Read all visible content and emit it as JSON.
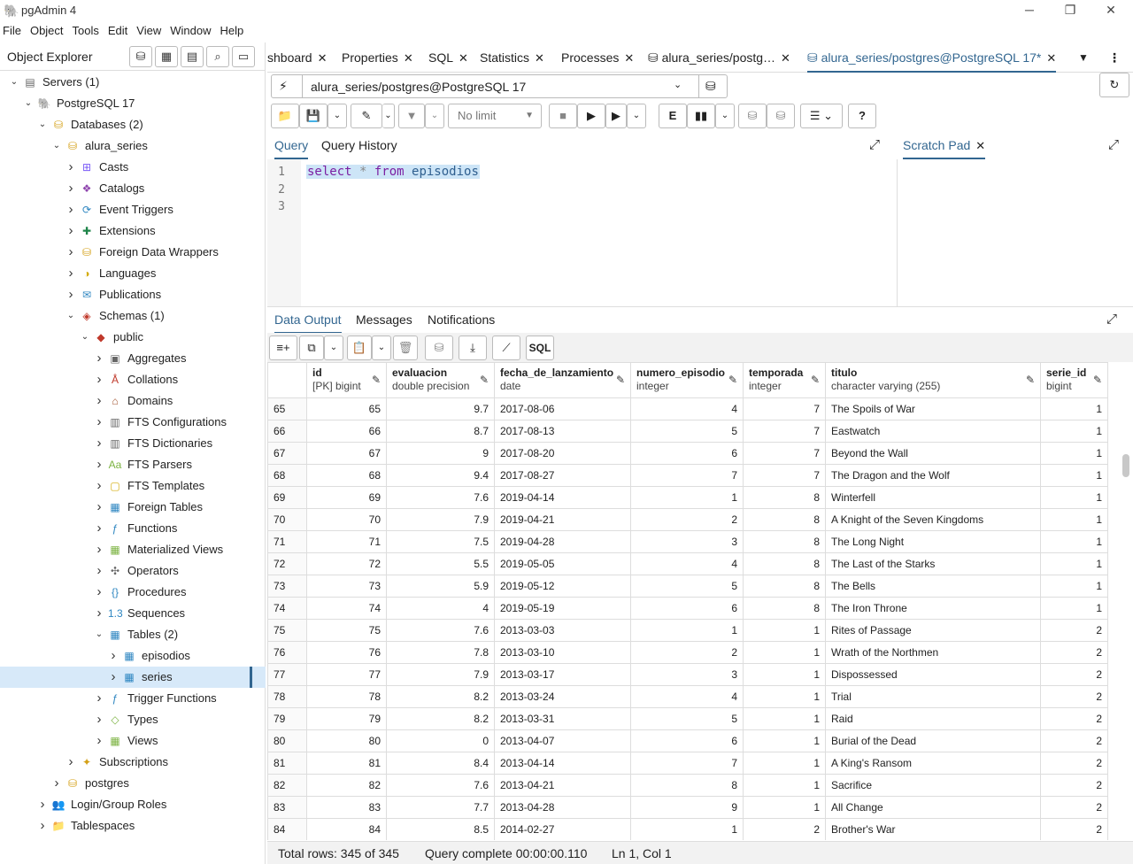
{
  "app": {
    "title": "pgAdmin 4"
  },
  "menu": [
    "File",
    "Object",
    "Tools",
    "Edit",
    "View",
    "Window",
    "Help"
  ],
  "object_explorer": {
    "title": "Object Explorer",
    "tree": [
      {
        "label": "Servers (1)",
        "icon": "servers-icon",
        "depth": 0,
        "chevron": "down"
      },
      {
        "label": "PostgreSQL 17",
        "icon": "elephant-icon",
        "depth": 1,
        "chevron": "down"
      },
      {
        "label": "Databases (2)",
        "icon": "databases-icon",
        "depth": 2,
        "chevron": "down"
      },
      {
        "label": "alura_series",
        "icon": "database-icon",
        "depth": 3,
        "chevron": "down"
      },
      {
        "label": "Casts",
        "icon": "casts-icon",
        "depth": 4,
        "chevron": "right"
      },
      {
        "label": "Catalogs",
        "icon": "catalogs-icon",
        "depth": 4,
        "chevron": "right"
      },
      {
        "label": "Event Triggers",
        "icon": "event-triggers-icon",
        "depth": 4,
        "chevron": "right"
      },
      {
        "label": "Extensions",
        "icon": "extensions-icon",
        "depth": 4,
        "chevron": "right"
      },
      {
        "label": "Foreign Data Wrappers",
        "icon": "fdw-icon",
        "depth": 4,
        "chevron": "right"
      },
      {
        "label": "Languages",
        "icon": "languages-icon",
        "depth": 4,
        "chevron": "right"
      },
      {
        "label": "Publications",
        "icon": "publications-icon",
        "depth": 4,
        "chevron": "right"
      },
      {
        "label": "Schemas (1)",
        "icon": "schemas-icon",
        "depth": 4,
        "chevron": "down"
      },
      {
        "label": "public",
        "icon": "schema-icon",
        "depth": 5,
        "chevron": "down"
      },
      {
        "label": "Aggregates",
        "icon": "aggregates-icon",
        "depth": 6,
        "chevron": "right"
      },
      {
        "label": "Collations",
        "icon": "collations-icon",
        "depth": 6,
        "chevron": "right"
      },
      {
        "label": "Domains",
        "icon": "domains-icon",
        "depth": 6,
        "chevron": "right"
      },
      {
        "label": "FTS Configurations",
        "icon": "fts-config-icon",
        "depth": 6,
        "chevron": "right"
      },
      {
        "label": "FTS Dictionaries",
        "icon": "fts-dict-icon",
        "depth": 6,
        "chevron": "right"
      },
      {
        "label": "FTS Parsers",
        "icon": "fts-parsers-icon",
        "depth": 6,
        "chevron": "right"
      },
      {
        "label": "FTS Templates",
        "icon": "fts-templates-icon",
        "depth": 6,
        "chevron": "right"
      },
      {
        "label": "Foreign Tables",
        "icon": "foreign-tables-icon",
        "depth": 6,
        "chevron": "right"
      },
      {
        "label": "Functions",
        "icon": "functions-icon",
        "depth": 6,
        "chevron": "right"
      },
      {
        "label": "Materialized Views",
        "icon": "mat-views-icon",
        "depth": 6,
        "chevron": "right"
      },
      {
        "label": "Operators",
        "icon": "operators-icon",
        "depth": 6,
        "chevron": "right"
      },
      {
        "label": "Procedures",
        "icon": "procedures-icon",
        "depth": 6,
        "chevron": "right"
      },
      {
        "label": "Sequences",
        "icon": "sequences-icon",
        "depth": 6,
        "chevron": "right"
      },
      {
        "label": "Tables (2)",
        "icon": "tables-icon",
        "depth": 6,
        "chevron": "down"
      },
      {
        "label": "episodios",
        "icon": "table-icon",
        "depth": 7,
        "chevron": "right"
      },
      {
        "label": "series",
        "icon": "table-icon",
        "depth": 7,
        "chevron": "right",
        "selected": true
      },
      {
        "label": "Trigger Functions",
        "icon": "trigger-functions-icon",
        "depth": 6,
        "chevron": "right"
      },
      {
        "label": "Types",
        "icon": "types-icon",
        "depth": 6,
        "chevron": "right"
      },
      {
        "label": "Views",
        "icon": "views-icon",
        "depth": 6,
        "chevron": "right"
      },
      {
        "label": "Subscriptions",
        "icon": "subscriptions-icon",
        "depth": 4,
        "chevron": "right"
      },
      {
        "label": "postgres",
        "icon": "database-icon",
        "depth": 3,
        "chevron": "right"
      },
      {
        "label": "Login/Group Roles",
        "icon": "roles-icon",
        "depth": 2,
        "chevron": "right"
      },
      {
        "label": "Tablespaces",
        "icon": "tablespaces-icon",
        "depth": 2,
        "chevron": "right"
      }
    ]
  },
  "tabs": [
    "shboard",
    "Properties",
    "SQL",
    "Statistics",
    "Processes",
    "alura_series/postg…",
    "alura_series/postgres@PostgreSQL 17*"
  ],
  "connection": "alura_series/postgres@PostgreSQL 17",
  "toolbar": {
    "limit": "No limit"
  },
  "query_tabs": [
    "Query",
    "Query History"
  ],
  "scratch_pad": "Scratch Pad",
  "editor": {
    "line_numbers": [
      "1",
      "2",
      "3"
    ],
    "tokens": [
      {
        "text": "select",
        "kind": "kw"
      },
      {
        "text": " * ",
        "kind": "op"
      },
      {
        "text": "from",
        "kind": "kw"
      },
      {
        "text": " episodios",
        "kind": "id"
      }
    ]
  },
  "output_tabs": [
    "Data Output",
    "Messages",
    "Notifications"
  ],
  "sql_button": "SQL",
  "grid": {
    "columns": [
      {
        "name": "id",
        "type": "[PK] bigint"
      },
      {
        "name": "evaluacion",
        "type": "double precision"
      },
      {
        "name": "fecha_de_lanzamiento",
        "type": "date"
      },
      {
        "name": "numero_episodio",
        "type": "integer"
      },
      {
        "name": "temporada",
        "type": "integer"
      },
      {
        "name": "titulo",
        "type": "character varying (255)"
      },
      {
        "name": "serie_id",
        "type": "bigint"
      }
    ],
    "rows": [
      [
        "65",
        "65",
        "9.7",
        "2017-08-06",
        "4",
        "7",
        "The Spoils of War",
        "1"
      ],
      [
        "66",
        "66",
        "8.7",
        "2017-08-13",
        "5",
        "7",
        "Eastwatch",
        "1"
      ],
      [
        "67",
        "67",
        "9",
        "2017-08-20",
        "6",
        "7",
        "Beyond the Wall",
        "1"
      ],
      [
        "68",
        "68",
        "9.4",
        "2017-08-27",
        "7",
        "7",
        "The Dragon and the Wolf",
        "1"
      ],
      [
        "69",
        "69",
        "7.6",
        "2019-04-14",
        "1",
        "8",
        "Winterfell",
        "1"
      ],
      [
        "70",
        "70",
        "7.9",
        "2019-04-21",
        "2",
        "8",
        "A Knight of the Seven Kingdoms",
        "1"
      ],
      [
        "71",
        "71",
        "7.5",
        "2019-04-28",
        "3",
        "8",
        "The Long Night",
        "1"
      ],
      [
        "72",
        "72",
        "5.5",
        "2019-05-05",
        "4",
        "8",
        "The Last of the Starks",
        "1"
      ],
      [
        "73",
        "73",
        "5.9",
        "2019-05-12",
        "5",
        "8",
        "The Bells",
        "1"
      ],
      [
        "74",
        "74",
        "4",
        "2019-05-19",
        "6",
        "8",
        "The Iron Throne",
        "1"
      ],
      [
        "75",
        "75",
        "7.6",
        "2013-03-03",
        "1",
        "1",
        "Rites of Passage",
        "2"
      ],
      [
        "76",
        "76",
        "7.8",
        "2013-03-10",
        "2",
        "1",
        "Wrath of the Northmen",
        "2"
      ],
      [
        "77",
        "77",
        "7.9",
        "2013-03-17",
        "3",
        "1",
        "Dispossessed",
        "2"
      ],
      [
        "78",
        "78",
        "8.2",
        "2013-03-24",
        "4",
        "1",
        "Trial",
        "2"
      ],
      [
        "79",
        "79",
        "8.2",
        "2013-03-31",
        "5",
        "1",
        "Raid",
        "2"
      ],
      [
        "80",
        "80",
        "0",
        "2013-04-07",
        "6",
        "1",
        "Burial of the Dead",
        "2"
      ],
      [
        "81",
        "81",
        "8.4",
        "2013-04-14",
        "7",
        "1",
        "A King's Ransom",
        "2"
      ],
      [
        "82",
        "82",
        "7.6",
        "2013-04-21",
        "8",
        "1",
        "Sacrifice",
        "2"
      ],
      [
        "83",
        "83",
        "7.7",
        "2013-04-28",
        "9",
        "1",
        "All Change",
        "2"
      ],
      [
        "84",
        "84",
        "8.5",
        "2014-02-27",
        "1",
        "2",
        "Brother's War",
        "2"
      ]
    ]
  },
  "status": {
    "total_rows": "Total rows: 345 of 345",
    "query_complete": "Query complete 00:00:00.110",
    "cursor": "Ln 1, Col 1"
  },
  "colors": {
    "accent": "#326690",
    "keyword": "#7b1fa2",
    "identifier": "#2f5f8f",
    "selection": "#d7e9f9"
  }
}
